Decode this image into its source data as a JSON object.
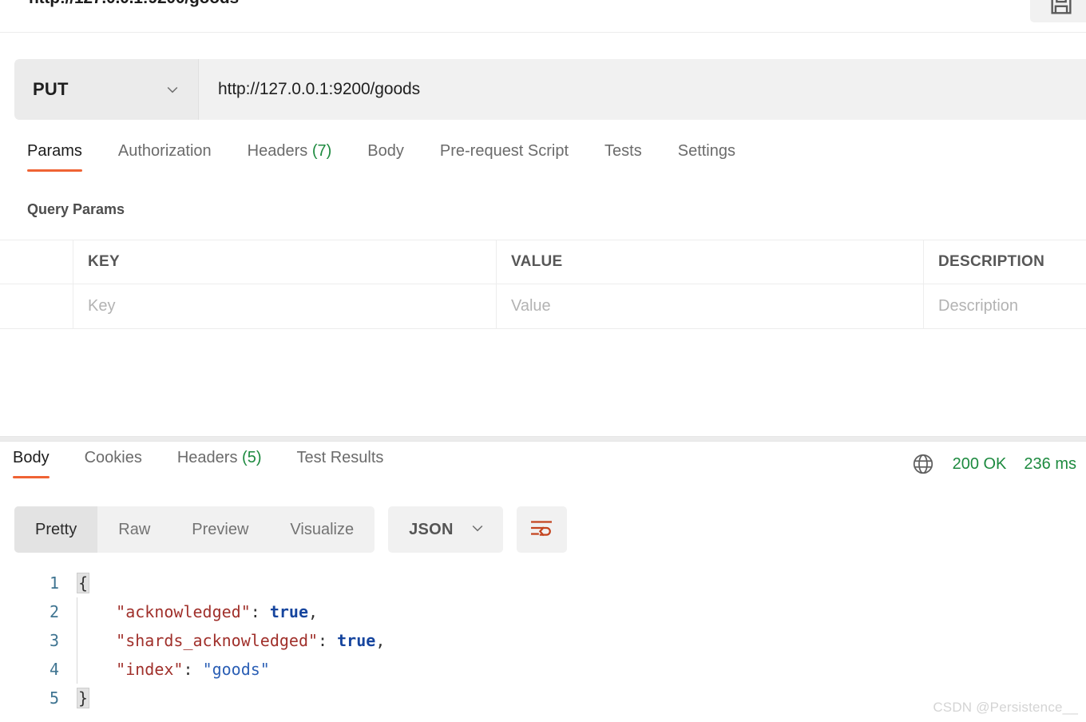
{
  "header": {
    "request_title": "http://127.0.0.1:9200/goods",
    "save_icon": "save-icon"
  },
  "request_bar": {
    "method": "PUT",
    "method_chevron": "chevron-down-icon",
    "url": "http://127.0.0.1:9200/goods"
  },
  "request_tabs": [
    {
      "label": "Params",
      "count": "",
      "active": true
    },
    {
      "label": "Authorization",
      "count": "",
      "active": false
    },
    {
      "label": "Headers",
      "count": "(7)",
      "active": false
    },
    {
      "label": "Body",
      "count": "",
      "active": false
    },
    {
      "label": "Pre-request Script",
      "count": "",
      "active": false
    },
    {
      "label": "Tests",
      "count": "",
      "active": false
    },
    {
      "label": "Settings",
      "count": "",
      "active": false
    }
  ],
  "params": {
    "section_title": "Query Params",
    "columns": [
      "KEY",
      "VALUE",
      "DESCRIPTION"
    ],
    "rows": [
      {
        "key_placeholder": "Key",
        "value_placeholder": "Value",
        "description_placeholder": "Description"
      }
    ]
  },
  "response_tabs": [
    {
      "label": "Body",
      "count": "",
      "active": true
    },
    {
      "label": "Cookies",
      "count": "",
      "active": false
    },
    {
      "label": "Headers",
      "count": "(5)",
      "active": false
    },
    {
      "label": "Test Results",
      "count": "",
      "active": false
    }
  ],
  "response_meta": {
    "globe_icon": "globe-icon",
    "status": "200 OK",
    "time": "236 ms",
    "status_color": "#1d8a3f"
  },
  "format_bar": {
    "views": [
      {
        "label": "Pretty",
        "active": true
      },
      {
        "label": "Raw",
        "active": false
      },
      {
        "label": "Preview",
        "active": false
      },
      {
        "label": "Visualize",
        "active": false
      }
    ],
    "language": "JSON",
    "language_chevron": "chevron-down-icon",
    "wrap_icon": "word-wrap-icon",
    "wrap_icon_color": "#c4441f"
  },
  "code": {
    "lines": [
      {
        "no": "1",
        "open_brace": "{"
      },
      {
        "no": "2",
        "key": "\"acknowledged\"",
        "colon": ": ",
        "bool": "true",
        "comma": ","
      },
      {
        "no": "3",
        "key": "\"shards_acknowledged\"",
        "colon": ": ",
        "bool": "true",
        "comma": ","
      },
      {
        "no": "4",
        "key": "\"index\"",
        "colon": ": ",
        "str": "\"goods\""
      },
      {
        "no": "5",
        "close_brace": "}"
      }
    ]
  },
  "watermark": "CSDN @Persistence__",
  "theme": {
    "accent": "#ef6334",
    "success": "#1d8a3f",
    "json_key": "#a0302b",
    "json_bool": "#16459e",
    "json_string": "#2b5fb5",
    "line_number": "#3f7491"
  }
}
